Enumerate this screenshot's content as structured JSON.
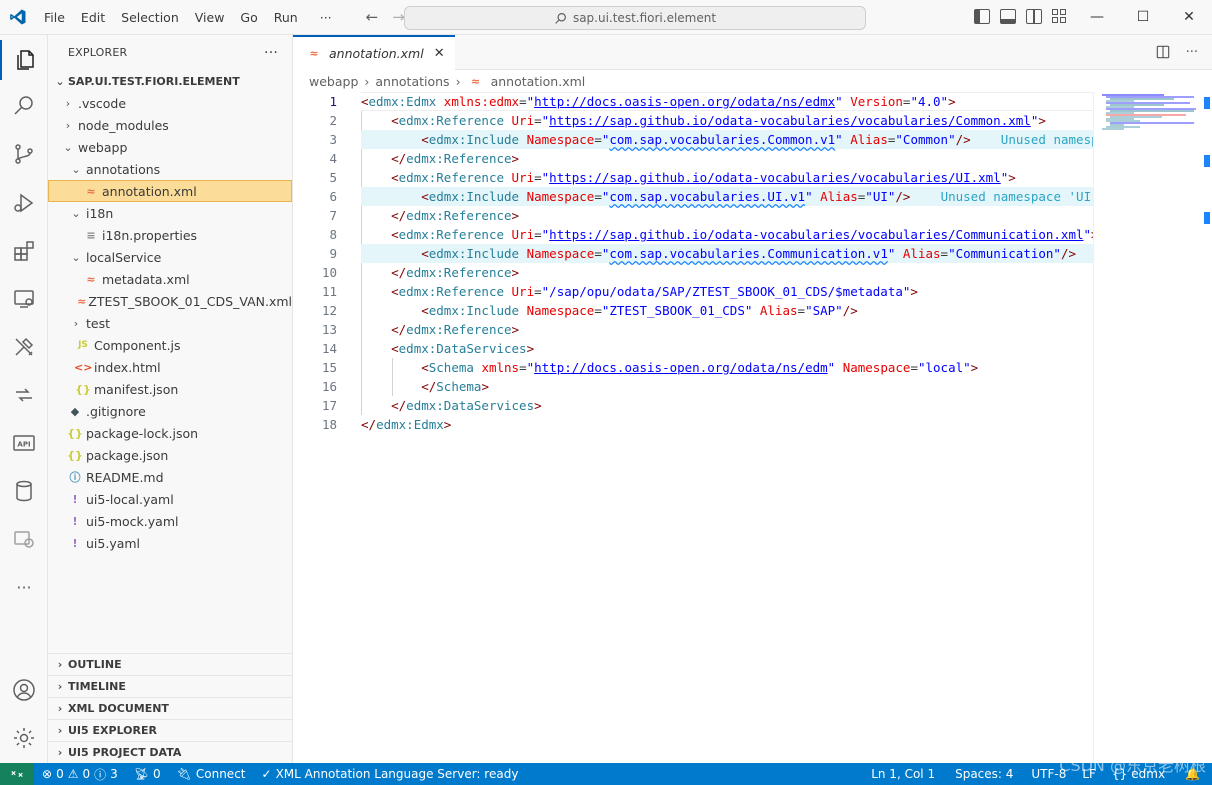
{
  "titlebar": {
    "menu": [
      "File",
      "Edit",
      "Selection",
      "View",
      "Go",
      "Run",
      "···"
    ],
    "search_text": "sap.ui.test.fiori.element",
    "window_controls": [
      "—",
      "☐",
      "✕"
    ]
  },
  "activitybar": {
    "icons": [
      "explorer-icon",
      "search-icon",
      "source-control-icon",
      "run-debug-icon",
      "extensions-icon",
      "remote-explorer-icon",
      "sap-tools-icon",
      "sap-flow-icon",
      "api-icon",
      "database-icon",
      "sap-ext-icon",
      "more-icon",
      "account-icon",
      "settings-gear-icon"
    ],
    "more_label": "···"
  },
  "sidebar": {
    "title": "EXPLORER",
    "more": "···",
    "root": "SAP.UI.TEST.FIORI.ELEMENT",
    "tree": [
      {
        "label": ".vscode",
        "chev": "›",
        "icon": "",
        "indent": 0
      },
      {
        "label": "node_modules",
        "chev": "›",
        "icon": "",
        "indent": 0
      },
      {
        "label": "webapp",
        "chev": "⌄",
        "icon": "",
        "indent": 0
      },
      {
        "label": "annotations",
        "chev": "⌄",
        "icon": "",
        "indent": 1
      },
      {
        "label": "annotation.xml",
        "chev": "",
        "icon": "xml",
        "indent": 2,
        "selected": true
      },
      {
        "label": "i18n",
        "chev": "⌄",
        "icon": "",
        "indent": 1
      },
      {
        "label": "i18n.properties",
        "chev": "",
        "icon": "prop",
        "indent": 2
      },
      {
        "label": "localService",
        "chev": "⌄",
        "icon": "",
        "indent": 1
      },
      {
        "label": "metadata.xml",
        "chev": "",
        "icon": "xml",
        "indent": 2
      },
      {
        "label": "ZTEST_SBOOK_01_CDS_VAN.xml",
        "chev": "",
        "icon": "xml",
        "indent": 2
      },
      {
        "label": "test",
        "chev": "›",
        "icon": "",
        "indent": 1
      },
      {
        "label": "Component.js",
        "chev": "",
        "icon": "js",
        "indent": 1
      },
      {
        "label": "index.html",
        "chev": "",
        "icon": "html",
        "indent": 1
      },
      {
        "label": "manifest.json",
        "chev": "",
        "icon": "json",
        "indent": 1
      },
      {
        "label": ".gitignore",
        "chev": "",
        "icon": "git",
        "indent": 0
      },
      {
        "label": "package-lock.json",
        "chev": "",
        "icon": "json",
        "indent": 0
      },
      {
        "label": "package.json",
        "chev": "",
        "icon": "json",
        "indent": 0
      },
      {
        "label": "README.md",
        "chev": "",
        "icon": "info",
        "indent": 0
      },
      {
        "label": "ui5-local.yaml",
        "chev": "",
        "icon": "yaml",
        "indent": 0
      },
      {
        "label": "ui5-mock.yaml",
        "chev": "",
        "icon": "yaml",
        "indent": 0
      },
      {
        "label": "ui5.yaml",
        "chev": "",
        "icon": "yaml",
        "indent": 0
      }
    ],
    "panels": [
      "OUTLINE",
      "TIMELINE",
      "XML DOCUMENT",
      "UI5 EXPLORER",
      "UI5 PROJECT DATA"
    ]
  },
  "editor": {
    "tab": {
      "label": "annotation.xml",
      "close": "✕"
    },
    "breadcrumb": [
      "webapp",
      "annotations",
      "annotation.xml"
    ],
    "lines": [
      [
        [
          "pu",
          "<"
        ],
        [
          "tb",
          "edmx:Edmx"
        ],
        [
          "x",
          " "
        ],
        [
          "at",
          "xmlns:edmx"
        ],
        [
          "x",
          "="
        ],
        [
          "av",
          "\""
        ],
        [
          "url",
          "http://docs.oasis-open.org/odata/ns/edmx"
        ],
        [
          "av",
          "\""
        ],
        [
          "x",
          " "
        ],
        [
          "at",
          "Version"
        ],
        [
          "x",
          "="
        ],
        [
          "av",
          "\"4.0\""
        ],
        [
          "pu",
          ">"
        ]
      ],
      [
        [
          "x",
          "    "
        ],
        [
          "pu",
          "<"
        ],
        [
          "tb",
          "edmx:Reference"
        ],
        [
          "x",
          " "
        ],
        [
          "at",
          "Uri"
        ],
        [
          "x",
          "="
        ],
        [
          "av",
          "\""
        ],
        [
          "url",
          "https://sap.github.io/odata-vocabularies/vocabularies/Common.xml"
        ],
        [
          "av",
          "\""
        ],
        [
          "pu",
          ">"
        ]
      ],
      [
        [
          "x",
          "        "
        ],
        [
          "pu",
          "<"
        ],
        [
          "tb",
          "edmx:Include"
        ],
        [
          "x",
          " "
        ],
        [
          "at",
          "Namespace"
        ],
        [
          "x",
          "="
        ],
        [
          "av",
          "\""
        ],
        [
          "sq",
          "com.sap.vocabularies.Common.v1"
        ],
        [
          "av",
          "\""
        ],
        [
          "x",
          " "
        ],
        [
          "at",
          "Alias"
        ],
        [
          "x",
          "="
        ],
        [
          "av",
          "\"Common\""
        ],
        [
          "pu",
          "/>"
        ],
        [
          "x",
          "    "
        ],
        [
          "hint",
          "Unused namespace 'Common'"
        ]
      ],
      [
        [
          "x",
          "    "
        ],
        [
          "pu",
          "</"
        ],
        [
          "tb",
          "edmx:Reference"
        ],
        [
          "pu",
          ">"
        ]
      ],
      [
        [
          "x",
          "    "
        ],
        [
          "pu",
          "<"
        ],
        [
          "tb",
          "edmx:Reference"
        ],
        [
          "x",
          " "
        ],
        [
          "at",
          "Uri"
        ],
        [
          "x",
          "="
        ],
        [
          "av",
          "\""
        ],
        [
          "url",
          "https://sap.github.io/odata-vocabularies/vocabularies/UI.xml"
        ],
        [
          "av",
          "\""
        ],
        [
          "pu",
          ">"
        ]
      ],
      [
        [
          "x",
          "        "
        ],
        [
          "pu",
          "<"
        ],
        [
          "tb",
          "edmx:Include"
        ],
        [
          "x",
          " "
        ],
        [
          "at",
          "Namespace"
        ],
        [
          "x",
          "="
        ],
        [
          "av",
          "\""
        ],
        [
          "sq",
          "com.sap.vocabularies.UI.v1"
        ],
        [
          "av",
          "\""
        ],
        [
          "x",
          " "
        ],
        [
          "at",
          "Alias"
        ],
        [
          "x",
          "="
        ],
        [
          "av",
          "\"UI\""
        ],
        [
          "pu",
          "/>"
        ],
        [
          "x",
          "    "
        ],
        [
          "hint",
          "Unused namespace 'UI'"
        ]
      ],
      [
        [
          "x",
          "    "
        ],
        [
          "pu",
          "</"
        ],
        [
          "tb",
          "edmx:Reference"
        ],
        [
          "pu",
          ">"
        ]
      ],
      [
        [
          "x",
          "    "
        ],
        [
          "pu",
          "<"
        ],
        [
          "tb",
          "edmx:Reference"
        ],
        [
          "x",
          " "
        ],
        [
          "at",
          "Uri"
        ],
        [
          "x",
          "="
        ],
        [
          "av",
          "\""
        ],
        [
          "url",
          "https://sap.github.io/odata-vocabularies/vocabularies/Communication.xml"
        ],
        [
          "av",
          "\""
        ],
        [
          "pu",
          ">"
        ]
      ],
      [
        [
          "x",
          "        "
        ],
        [
          "pu",
          "<"
        ],
        [
          "tb",
          "edmx:Include"
        ],
        [
          "x",
          " "
        ],
        [
          "at",
          "Namespace"
        ],
        [
          "x",
          "="
        ],
        [
          "av",
          "\""
        ],
        [
          "sq",
          "com.sap.vocabularies.Communication.v1"
        ],
        [
          "av",
          "\""
        ],
        [
          "x",
          " "
        ],
        [
          "at",
          "Alias"
        ],
        [
          "x",
          "="
        ],
        [
          "av",
          "\"Communication\""
        ],
        [
          "pu",
          "/>"
        ]
      ],
      [
        [
          "x",
          "    "
        ],
        [
          "pu",
          "</"
        ],
        [
          "tb",
          "edmx:Reference"
        ],
        [
          "pu",
          ">"
        ]
      ],
      [
        [
          "x",
          "    "
        ],
        [
          "pu",
          "<"
        ],
        [
          "tb",
          "edmx:Reference"
        ],
        [
          "x",
          " "
        ],
        [
          "at",
          "Uri"
        ],
        [
          "x",
          "="
        ],
        [
          "av",
          "\"/sap/opu/odata/SAP/ZTEST_SBOOK_01_CDS/$metadata\""
        ],
        [
          "pu",
          ">"
        ]
      ],
      [
        [
          "x",
          "        "
        ],
        [
          "pu",
          "<"
        ],
        [
          "tb",
          "edmx:Include"
        ],
        [
          "x",
          " "
        ],
        [
          "at",
          "Namespace"
        ],
        [
          "x",
          "="
        ],
        [
          "av",
          "\"ZTEST_SBOOK_01_CDS\""
        ],
        [
          "x",
          " "
        ],
        [
          "at",
          "Alias"
        ],
        [
          "x",
          "="
        ],
        [
          "av",
          "\"SAP\""
        ],
        [
          "pu",
          "/>"
        ]
      ],
      [
        [
          "x",
          "    "
        ],
        [
          "pu",
          "</"
        ],
        [
          "tb",
          "edmx:Reference"
        ],
        [
          "pu",
          ">"
        ]
      ],
      [
        [
          "x",
          "    "
        ],
        [
          "pu",
          "<"
        ],
        [
          "tb",
          "edmx:DataServices"
        ],
        [
          "pu",
          ">"
        ]
      ],
      [
        [
          "x",
          "        "
        ],
        [
          "pu",
          "<"
        ],
        [
          "tb",
          "Schema"
        ],
        [
          "x",
          " "
        ],
        [
          "at",
          "xmlns"
        ],
        [
          "x",
          "="
        ],
        [
          "av",
          "\""
        ],
        [
          "url",
          "http://docs.oasis-open.org/odata/ns/edm"
        ],
        [
          "av",
          "\""
        ],
        [
          "x",
          " "
        ],
        [
          "at",
          "Namespace"
        ],
        [
          "x",
          "="
        ],
        [
          "av",
          "\"local\""
        ],
        [
          "pu",
          ">"
        ]
      ],
      [
        [
          "x",
          "        "
        ],
        [
          "pu",
          "</"
        ],
        [
          "tb",
          "Schema"
        ],
        [
          "pu",
          ">"
        ]
      ],
      [
        [
          "x",
          "    "
        ],
        [
          "pu",
          "</"
        ],
        [
          "tb",
          "edmx:DataServices"
        ],
        [
          "pu",
          ">"
        ]
      ],
      [
        [
          "pu",
          "</"
        ],
        [
          "tb",
          "edmx:Edmx"
        ],
        [
          "pu",
          ">"
        ]
      ]
    ],
    "highlighted_lines": [
      3,
      6,
      9
    ],
    "current_line": 1
  },
  "statusbar": {
    "remote": "⚡",
    "problems": "0",
    "warnings": "0",
    "info": "3",
    "ports": "0",
    "connect": "Connect",
    "xml_server": "XML Annotation Language Server: ready",
    "position": "Ln 1, Col 1",
    "spaces": "Spaces: 4",
    "encoding": "UTF-8",
    "eol": "LF",
    "language": "edmx",
    "bell": "🔔"
  },
  "watermark": "CSDN @东京老树根"
}
